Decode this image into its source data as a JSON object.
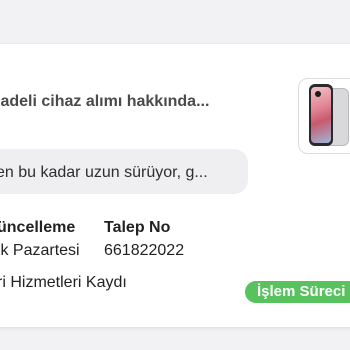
{
  "ticket": {
    "subject": "iadeli cihaz alımı hakkında...",
    "last_message": "en bu kadar uzun sürüyor, g...",
    "update_label": "üncelleme",
    "update_value": "ık Pazartesi",
    "request_label": "Talep No",
    "request_value": "661822022",
    "record_type": "ri Hizmetleri Kaydı",
    "status": "İşlem Süreci",
    "status_color": "#58c25e",
    "product_image": "phone-image"
  }
}
